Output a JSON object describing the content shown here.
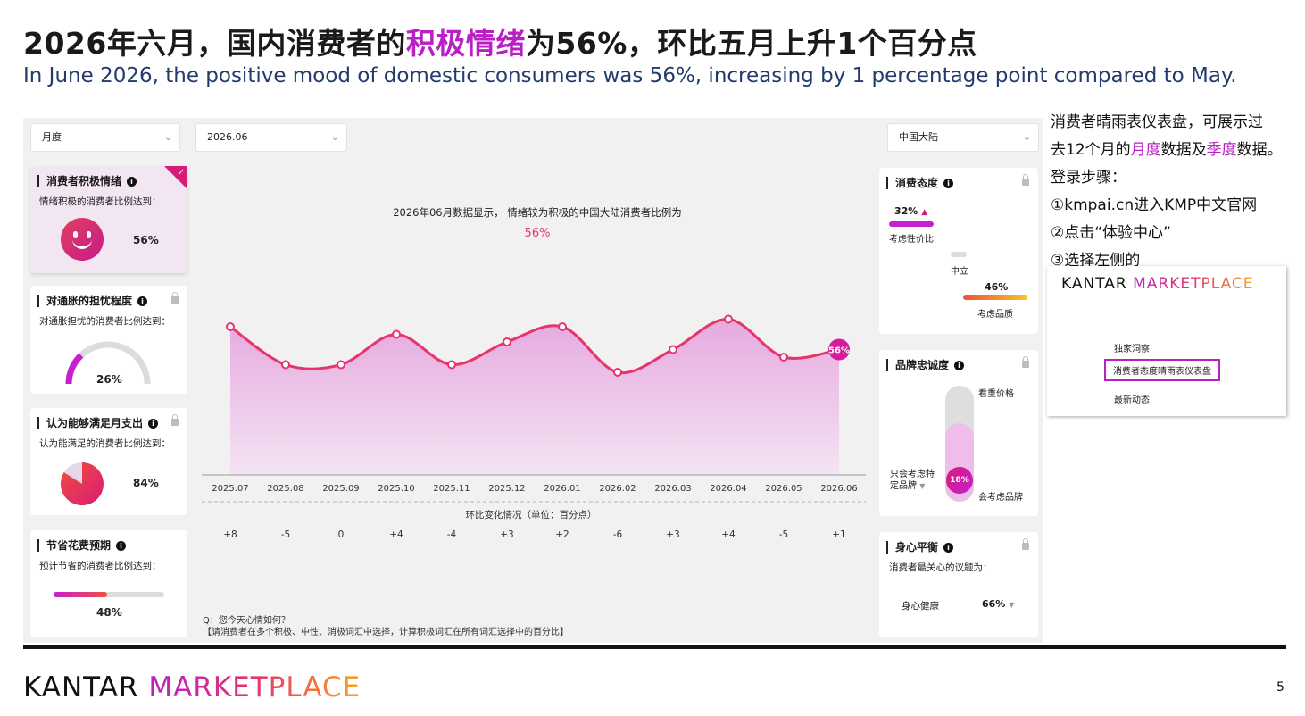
{
  "headline": {
    "part1": "2026年六月，国内消费者的",
    "highlight": "积极情绪",
    "part2": "为56%，环比五月上升1个百分点"
  },
  "subheadline": "In June 2026, the positive mood of domestic consumers was 56%, increasing by 1 percentage point compared to May.",
  "filters": {
    "period": "月度",
    "month": "2026.06",
    "region": "中国大陆"
  },
  "left_cards": [
    {
      "title": "消费者积极情绪",
      "sub": "情绪积极的消费者比例达到：",
      "value": "56%",
      "active": true
    },
    {
      "title": "对通胀的担忧程度",
      "sub": "对通胀担忧的消费者比例达到：",
      "value": "26%",
      "locked": true
    },
    {
      "title": "认为能够满足月支出",
      "sub": "认为能满足的消费者比例达到：",
      "value": "84%",
      "locked": true
    },
    {
      "title": "节省花费预期",
      "sub": "预计节省的消费者比例达到：",
      "value": "48%"
    }
  ],
  "right_cards": {
    "attitude": {
      "title": "消费态度",
      "price_value": "32%",
      "price_label": "考虑性价比",
      "neutral_label": "中立",
      "quality_value": "46%",
      "quality_label": "考虑品质"
    },
    "loyalty": {
      "title": "品牌忠诚度",
      "top_label": "看重价格",
      "left_label_1": "只会考虑特",
      "left_label_2": "定品牌",
      "value": "18%",
      "bottom_label": "会考虑品牌"
    },
    "wellbeing": {
      "title": "身心平衡",
      "sub": "消费者最关心的议题为：",
      "topic": "身心健康",
      "value": "66%"
    }
  },
  "chart_caption": "2026年06月数据显示， 情绪较为积极的中国大陆消费者比例为",
  "chart_caption_value": "56%",
  "change_caption": "环比变化情况（单位：百分点）",
  "question_line1": "Q：您今天心情如何？",
  "question_line2": "【请消费者在多个积极、中性、消极词汇中选择，计算积极词汇在所有词汇选择中的百分比】",
  "chart_data": {
    "type": "area",
    "x": [
      "2025.07",
      "2025.08",
      "2025.09",
      "2025.10",
      "2025.11",
      "2025.12",
      "2026.01",
      "2026.02",
      "2026.03",
      "2026.04",
      "2026.05",
      "2026.06"
    ],
    "series": [
      {
        "values": [
          58,
          53,
          53,
          57,
          53,
          56,
          58,
          52,
          55,
          59,
          54,
          55
        ]
      }
    ],
    "changes": [
      "+8",
      "-5",
      "0",
      "+4",
      "-4",
      "+3",
      "+2",
      "-6",
      "+3",
      "+4",
      "-5",
      "+1"
    ],
    "last_label": "56%",
    "ylim": [
      0,
      100
    ],
    "colors": {
      "line": "#e8336d",
      "fill_top": "#e6a9df",
      "fill_bottom": "#f4e4f3"
    }
  },
  "side_note": {
    "line1": "消费者晴雨表仪表盘，可展示过",
    "line2_a": "去12个月的",
    "line2_b": "月度",
    "line2_c": "数据及",
    "line2_d": "季度",
    "line2_e": "数据。",
    "line3": "登录步骤：",
    "line4": "①kmpai.cn进入KMP中文官网",
    "line5": "②点击“体验中心”",
    "line6": "③选择左侧的"
  },
  "side_panel": {
    "brand_k": "KANTAR",
    "brand_m": "MARKETPLACE",
    "menu_1": "独家洞察",
    "menu_2": "消费者态度晴雨表仪表盘",
    "menu_3": "最新动态"
  },
  "footer": {
    "brand_k": "KANTAR",
    "brand_m": "MARKETPLACE",
    "page": "5"
  }
}
